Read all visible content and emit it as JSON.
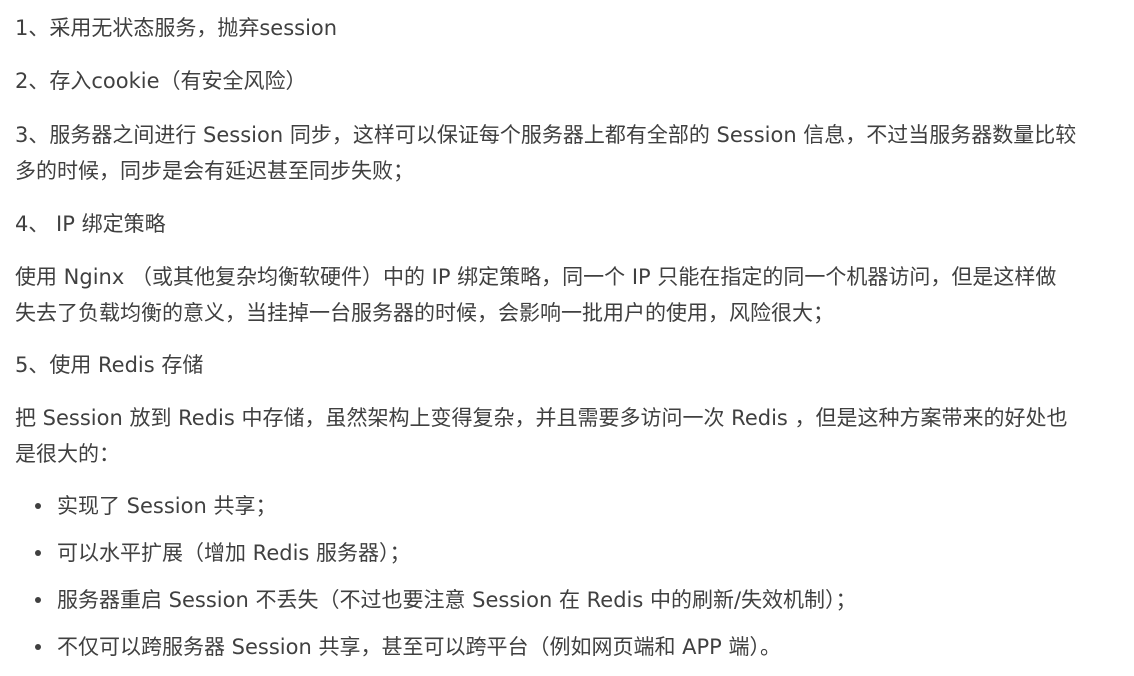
{
  "items": [
    {
      "lines": [
        "1、采用无状态服务，抛弃session"
      ]
    },
    {
      "lines": [
        "2、存入cookie（有安全风险）"
      ]
    },
    {
      "lines": [
        "3、服务器之间进行 Session 同步，这样可以保证每个服务器上都有全部的 Session 信息，不过当服务器数量比较",
        "多的时候，同步是会有延迟甚至同步失败；"
      ]
    },
    {
      "lines": [
        "4、 IP 绑定策略"
      ]
    },
    {
      "lines": [
        "使用 Nginx （或其他复杂均衡软硬件）中的 IP 绑定策略，同一个 IP 只能在指定的同一个机器访问，但是这样做",
        "失去了负载均衡的意义，当挂掉一台服务器的时候，会影响一批用户的使用，风险很大；"
      ]
    },
    {
      "lines": [
        "5、使用 Redis 存储"
      ]
    },
    {
      "lines": [
        "把 Session 放到 Redis 中存储，虽然架构上变得复杂，并且需要多访问一次 Redis ，但是这种方案带来的好处也",
        "是很大的："
      ]
    }
  ],
  "bullets": [
    "实现了 Session 共享；",
    "可以水平扩展（增加 Redis 服务器）；",
    "服务器重启 Session 不丢失（不过也要注意 Session 在 Redis 中的刷新/失效机制）；",
    "不仅可以跨服务器 Session 共享，甚至可以跨平台（例如网页端和 APP 端）。"
  ]
}
